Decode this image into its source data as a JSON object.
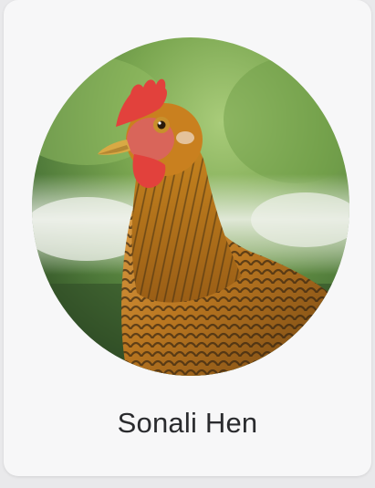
{
  "card": {
    "title": "Sonali Hen"
  },
  "image": {
    "subject": "hen-photo",
    "colors": {
      "background_green": "#7fae55",
      "feather_gold": "#c9861f",
      "feather_dark": "#3a2a12",
      "comb_red": "#e2413c",
      "beak_yellow": "#d9a944"
    }
  }
}
